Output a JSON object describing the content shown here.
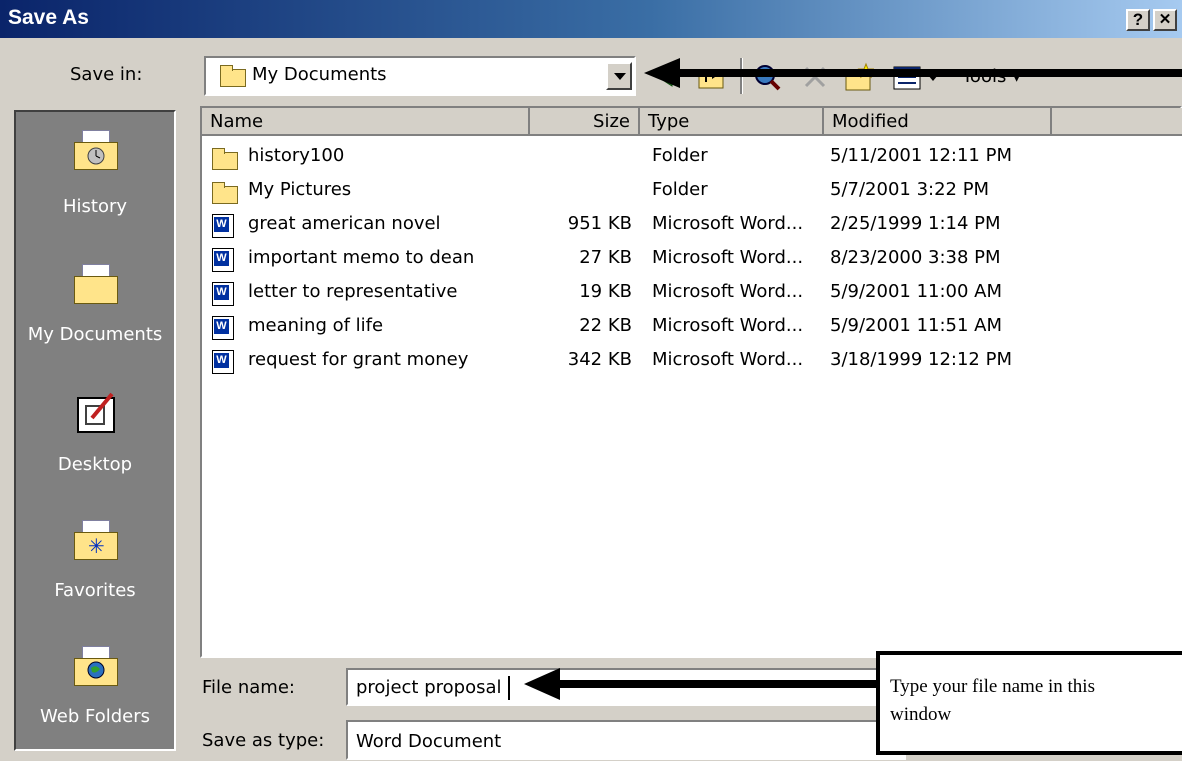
{
  "window": {
    "title": "Save As",
    "help_label": "?",
    "close_label": "✕"
  },
  "save_in": {
    "label": "Save in:",
    "value": "My Documents"
  },
  "toolbar": {
    "tools_label": "Tools",
    "tools_arrow": "▾"
  },
  "places": [
    {
      "label": "History",
      "icon": "history-icon"
    },
    {
      "label": "My Documents",
      "icon": "my-documents-icon"
    },
    {
      "label": "Desktop",
      "icon": "desktop-icon"
    },
    {
      "label": "Favorites",
      "icon": "favorites-icon"
    },
    {
      "label": "Web Folders",
      "icon": "web-folders-icon"
    }
  ],
  "columns": {
    "name": "Name",
    "size": "Size",
    "type": "Type",
    "modified": "Modified"
  },
  "files": [
    {
      "name": "history100",
      "size": "",
      "type": "Folder",
      "modified": "5/11/2001 12:11 PM",
      "icon": "folder-icon"
    },
    {
      "name": "My Pictures",
      "size": "",
      "type": "Folder",
      "modified": "5/7/2001 3:22 PM",
      "icon": "folder-icon"
    },
    {
      "name": "great american novel",
      "size": "951 KB",
      "type": "Microsoft Word...",
      "modified": "2/25/1999 1:14 PM",
      "icon": "word-document-icon"
    },
    {
      "name": "important memo to dean",
      "size": "27 KB",
      "type": "Microsoft Word...",
      "modified": "8/23/2000 3:38 PM",
      "icon": "word-document-icon"
    },
    {
      "name": "letter to representative",
      "size": "19 KB",
      "type": "Microsoft Word...",
      "modified": "5/9/2001 11:00 AM",
      "icon": "word-document-icon"
    },
    {
      "name": "meaning of life",
      "size": "22 KB",
      "type": "Microsoft Word...",
      "modified": "5/9/2001 11:51 AM",
      "icon": "word-document-icon"
    },
    {
      "name": "request for grant money",
      "size": "342 KB",
      "type": "Microsoft Word...",
      "modified": "3/18/1999 12:12 PM",
      "icon": "word-document-icon"
    }
  ],
  "file_name": {
    "label": "File name:",
    "value": "project proposal"
  },
  "save_as_type": {
    "label": "Save as type:",
    "value": "Word Document"
  },
  "callout": {
    "line1": "Type your file name in this",
    "line2": "window"
  },
  "colors": {
    "title_start": "#0a246a",
    "title_end": "#a6caf0",
    "face": "#d4d0c8",
    "places_bg": "#808080",
    "word_blue": "#0030a0",
    "folder_yellow": "#ffe48a"
  }
}
